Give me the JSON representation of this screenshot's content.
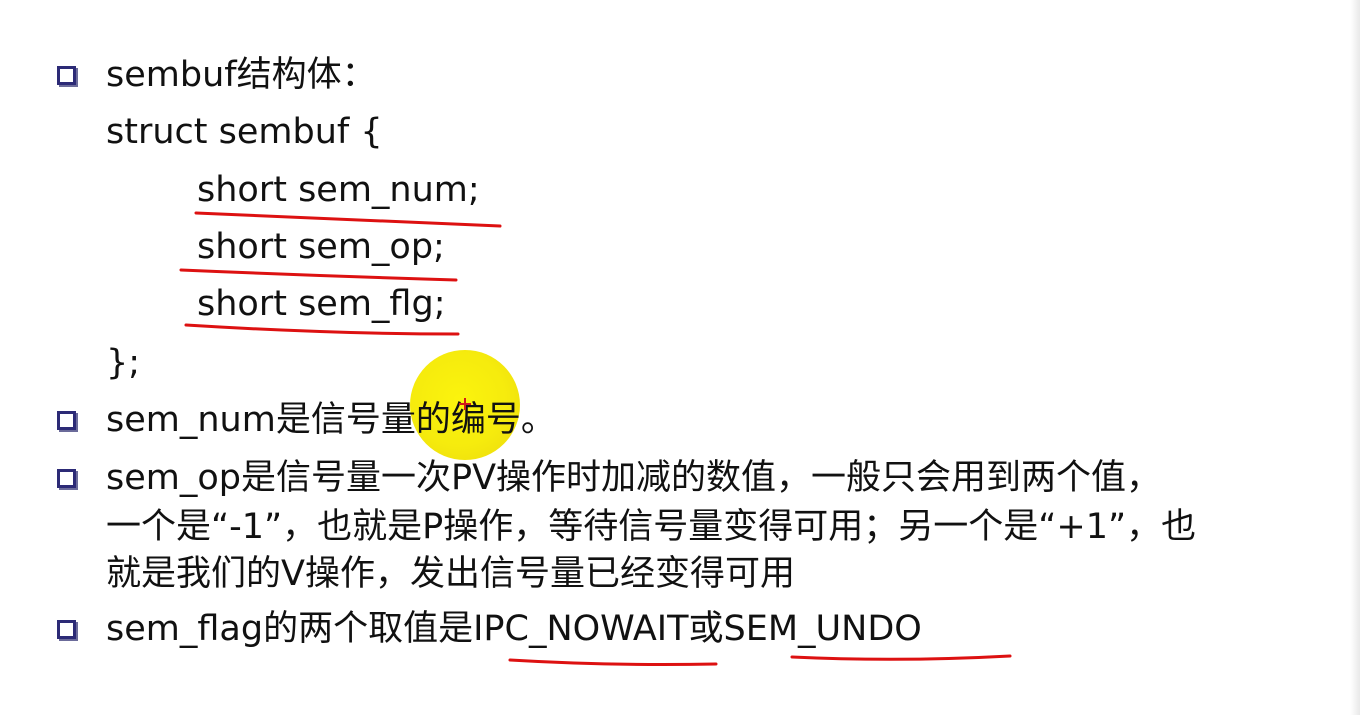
{
  "slide": {
    "bullets": [
      {
        "text": "sembuf结构体："
      },
      {
        "text": "sem_num是信号量的编号。"
      },
      {
        "text": "sem_op是信号量一次PV操作时加减的数值，一般只会用到两个值，"
      },
      {
        "text": "sem_flag的两个取值是IPC_NOWAIT或SEM_UNDO"
      }
    ],
    "code": {
      "open": "struct sembuf {",
      "fields": [
        "short sem_num;",
        "short sem_op;",
        "short sem_flg;"
      ],
      "close": "};"
    },
    "continuation": [
      "一个是“-1”，也就是P操作，等待信号量变得可用；另一个是“+1”，也",
      "就是我们的V操作，发出信号量已经变得可用"
    ]
  },
  "colors": {
    "bullet_border": "#2c2a76",
    "annotation_red": "#dd1111",
    "highlight_yellow": "#f5ea00"
  }
}
